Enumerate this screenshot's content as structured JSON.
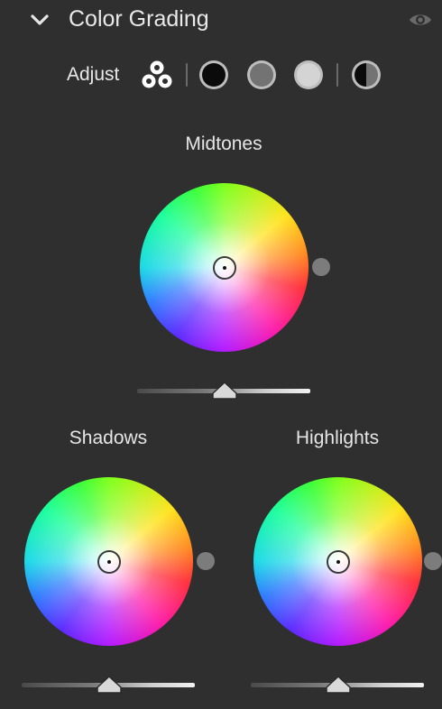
{
  "header": {
    "title": "Color Grading",
    "collapse_icon": "chevron-down-icon",
    "visibility_icon": "eye-icon"
  },
  "adjust": {
    "label": "Adjust",
    "modes": [
      {
        "name": "3-way",
        "icon": "three-way-icon",
        "selected": true
      },
      {
        "name": "Shadows",
        "icon": "dark-circle-icon",
        "selected": false
      },
      {
        "name": "Midtones",
        "icon": "mid-circle-icon",
        "selected": false
      },
      {
        "name": "Highlights",
        "icon": "light-circle-icon",
        "selected": false
      },
      {
        "name": "Global",
        "icon": "half-circle-icon",
        "selected": false
      }
    ]
  },
  "wheels": {
    "midtones": {
      "label": "Midtones",
      "hue": 0,
      "saturation": 0,
      "luminance": 0
    },
    "shadows": {
      "label": "Shadows",
      "hue": 0,
      "saturation": 0,
      "luminance": 0
    },
    "highlights": {
      "label": "Highlights",
      "hue": 0,
      "saturation": 0,
      "luminance": 0
    }
  },
  "colors": {
    "panel_bg": "#2f2f2f",
    "text": "#e6e6e6",
    "knob": "#7c7c7c"
  }
}
